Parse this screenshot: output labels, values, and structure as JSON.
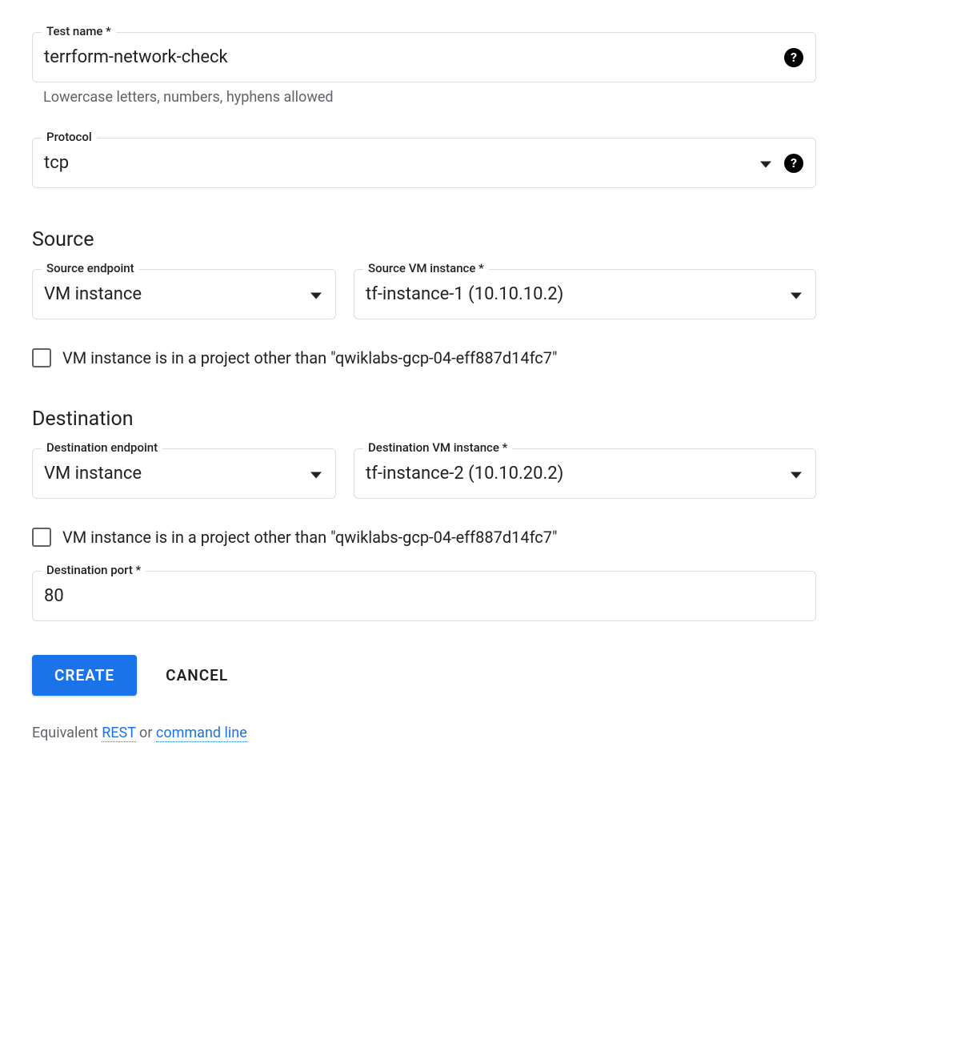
{
  "testName": {
    "label": "Test name *",
    "value": "terrform-network-check",
    "helper": "Lowercase letters, numbers, hyphens allowed"
  },
  "protocol": {
    "label": "Protocol",
    "value": "tcp"
  },
  "source": {
    "heading": "Source",
    "endpoint": {
      "label": "Source endpoint",
      "value": "VM instance"
    },
    "vm": {
      "label": "Source VM instance *",
      "value": "tf-instance-1 (10.10.10.2)"
    },
    "otherProjectLabel": "VM instance is in a project other than \"qwiklabs-gcp-04-eff887d14fc7\""
  },
  "destination": {
    "heading": "Destination",
    "endpoint": {
      "label": "Destination endpoint",
      "value": "VM instance"
    },
    "vm": {
      "label": "Destination VM instance *",
      "value": "tf-instance-2 (10.10.20.2)"
    },
    "otherProjectLabel": "VM instance is in a project other than \"qwiklabs-gcp-04-eff887d14fc7\"",
    "port": {
      "label": "Destination port *",
      "value": "80"
    }
  },
  "buttons": {
    "create": "CREATE",
    "cancel": "CANCEL"
  },
  "equivalent": {
    "prefix": "Equivalent ",
    "rest": "REST",
    "or": " or ",
    "cmd": "command line"
  }
}
